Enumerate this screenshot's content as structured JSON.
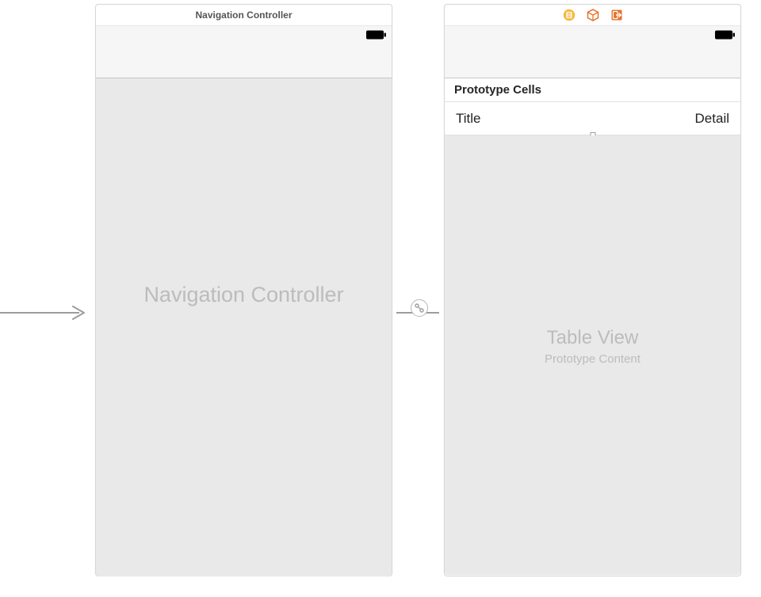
{
  "left_scene": {
    "dock_title": "Navigation Controller",
    "placeholder": "Navigation Controller"
  },
  "right_scene": {
    "proto_header": "Prototype Cells",
    "cell_title": "Title",
    "cell_detail": "Detail",
    "placeholder_main": "Table View",
    "placeholder_sub": "Prototype Content"
  },
  "icons": {
    "circle": "storyboard-entry-icon",
    "cube": "first-responder-icon",
    "exit": "exit-icon"
  }
}
